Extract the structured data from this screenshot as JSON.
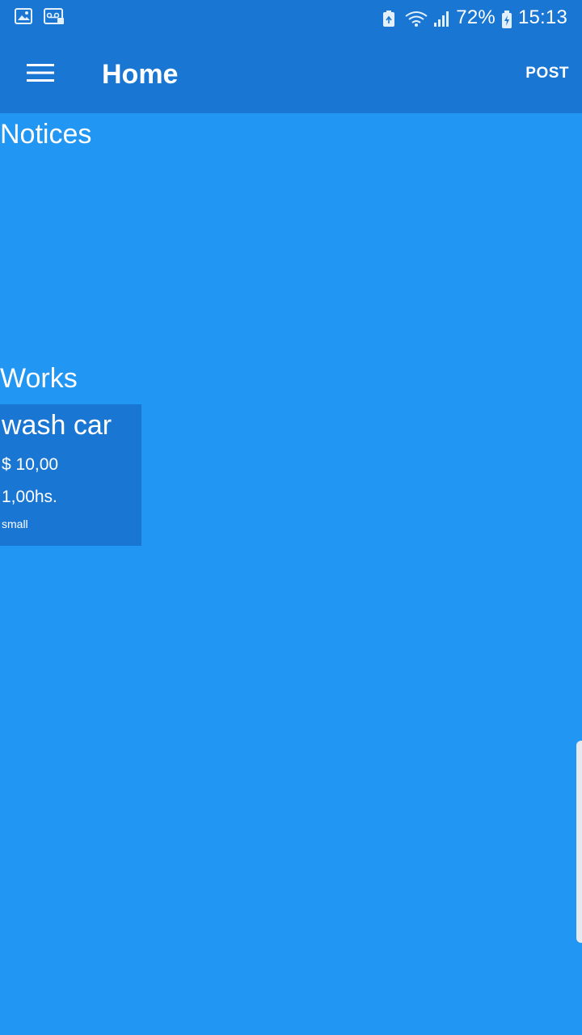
{
  "status_bar": {
    "left_icons": [
      "gallery-icon",
      "voicemail-icon"
    ],
    "right_icons": [
      "battery-saver-icon",
      "wifi-icon",
      "signal-icon",
      "battery-charging-icon"
    ],
    "battery_percent": "72%",
    "time": "15:13"
  },
  "app_bar": {
    "menu_icon": "hamburger-menu-icon",
    "title": "Home",
    "action_label": "POST"
  },
  "sections": {
    "notices_title": "Notices",
    "works_title": "Works"
  },
  "works": [
    {
      "name": "wash car",
      "price": "$ 10,00",
      "duration": "1,00hs.",
      "size": "small"
    }
  ],
  "colors": {
    "background": "#2196F3",
    "app_bar": "#1976D2",
    "card": "#1976D2",
    "text": "#FFFFFF"
  }
}
